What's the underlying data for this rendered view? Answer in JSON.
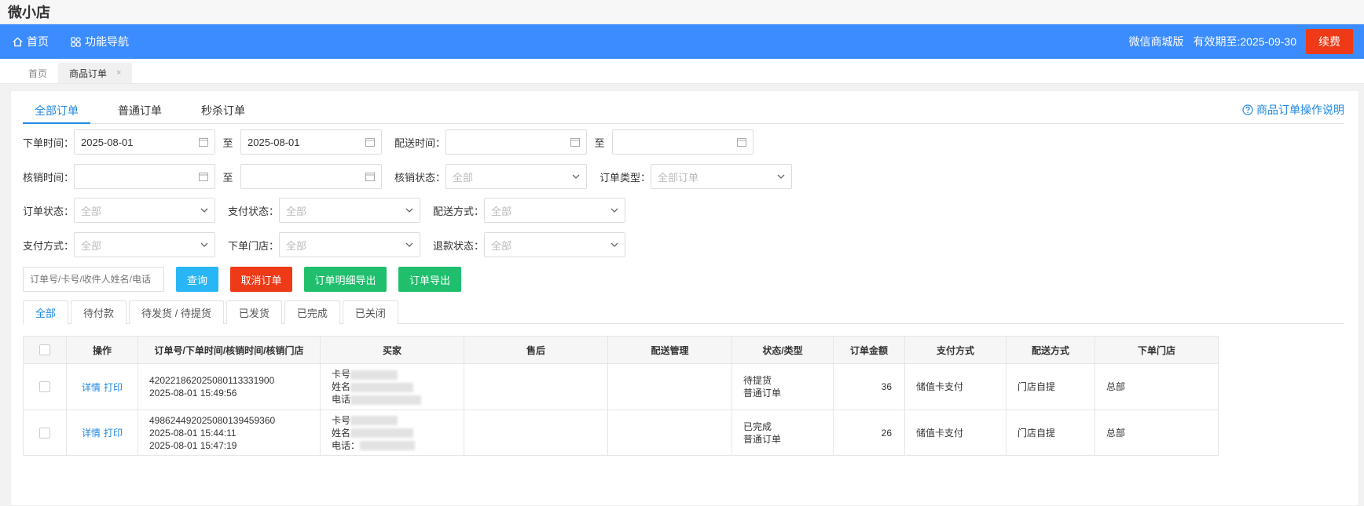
{
  "app": {
    "title": "微小店"
  },
  "topnav": {
    "home_label": "首页",
    "nav_label": "功能导航",
    "edition": "微信商城版",
    "expire": "有效期至:2025-09-30",
    "renew_label": "续费"
  },
  "page_tabs": [
    {
      "label": "首页"
    },
    {
      "label": "商品订单",
      "close": "×"
    }
  ],
  "order_tabs": [
    {
      "label": "全部订单"
    },
    {
      "label": "普通订单"
    },
    {
      "label": "秒杀订单"
    }
  ],
  "help_link": "商品订单操作说明",
  "filters": {
    "order_time_label": "下单时间：",
    "order_time_from": "2025-08-01",
    "order_time_to": "2025-08-01",
    "to_label": "至",
    "delivery_time_label": "配送时间：",
    "verify_time_label": "核销时间：",
    "verify_status_label": "核销状态：",
    "verify_status_value": "全部",
    "order_type_label": "订单类型：",
    "order_type_value": "全部订单",
    "order_status_label": "订单状态：",
    "order_status_value": "全部",
    "pay_status_label": "支付状态：",
    "pay_status_value": "全部",
    "delivery_method_label": "配送方式：",
    "delivery_method_value": "全部",
    "pay_method_label": "支付方式：",
    "pay_method_value": "全部",
    "store_label": "下单门店：",
    "store_value": "全部",
    "refund_status_label": "退款状态：",
    "refund_status_value": "全部",
    "search_placeholder": "订单号/卡号/收件人姓名/电话"
  },
  "actions": {
    "query": "查询",
    "cancel": "取消订单",
    "export_detail": "订单明细导出",
    "export": "订单导出"
  },
  "colors": {
    "primary": "#3b8cff",
    "query_btn": "#29b6f6",
    "cancel_btn": "#ee3a16",
    "export_btn": "#1fbf6e",
    "link": "#1e88e5"
  },
  "status_tabs": [
    "全部",
    "待付款",
    "待发货 / 待提货",
    "已发货",
    "已完成",
    "已关闭"
  ],
  "table": {
    "columns": [
      "操作",
      "订单号/下单时间/核销时间/核销门店",
      "买家",
      "售后",
      "配送管理",
      "状态/类型",
      "订单金额",
      "支付方式",
      "配送方式",
      "下单门店"
    ],
    "rows": [
      {
        "ops": [
          "详情",
          "打印"
        ],
        "order_no": "420221862025080113331900",
        "order_time": "2025-08-01 15:49:56",
        "verify_time": "",
        "buyer": [
          "卡号",
          "姓名",
          "电话"
        ],
        "status": "待提货",
        "type": "普通订单",
        "amount": "36",
        "pay_method": "储值卡支付",
        "delivery": "门店自提",
        "store": "总部"
      },
      {
        "ops": [
          "详情",
          "打印"
        ],
        "order_no": "498624492025080139459360",
        "order_time": "2025-08-01 15:44:11",
        "verify_time": "2025-08-01 15:47:19",
        "buyer": [
          "卡号",
          "姓名",
          "电话："
        ],
        "status": "已完成",
        "type": "普通订单",
        "amount": "26",
        "pay_method": "储值卡支付",
        "delivery": "门店自提",
        "store": "总部"
      }
    ]
  }
}
